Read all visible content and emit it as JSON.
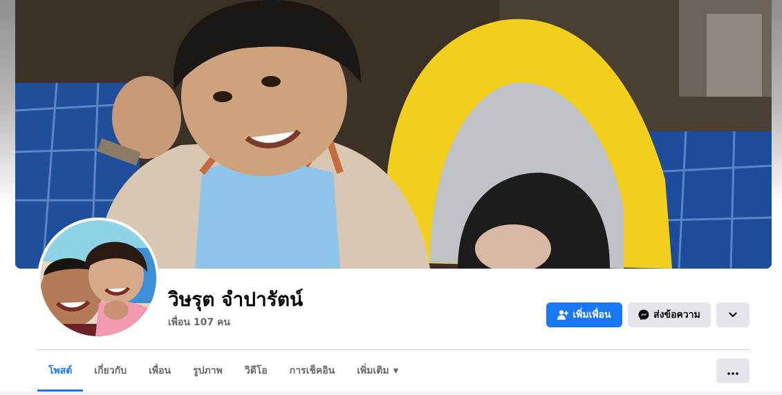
{
  "profile": {
    "name": "วิษรุต จำปารัตน์",
    "friends_count": "เพื่อน 107 คน"
  },
  "actions": {
    "add_friend": "เพิ่มเพื่อน",
    "message": "ส่งข้อความ"
  },
  "tabs": [
    {
      "label": "โพสต์",
      "active": true
    },
    {
      "label": "เกี่ยวกับ",
      "active": false
    },
    {
      "label": "เพื่อน",
      "active": false
    },
    {
      "label": "รูปภาพ",
      "active": false
    },
    {
      "label": "วิดีโอ",
      "active": false
    },
    {
      "label": "การเช็คอิน",
      "active": false
    },
    {
      "label": "เพิ่มเติม",
      "active": false
    }
  ],
  "colors": {
    "accent": "#1877f2",
    "secondary_button": "#e4e6eb",
    "muted_text": "#65676b"
  },
  "icons": {
    "add_friend": "person-plus-icon",
    "message": "messenger-icon",
    "more_dropdown": "chevron-down-icon",
    "more_tab": "caret-down-icon",
    "options": "ellipsis-icon"
  }
}
